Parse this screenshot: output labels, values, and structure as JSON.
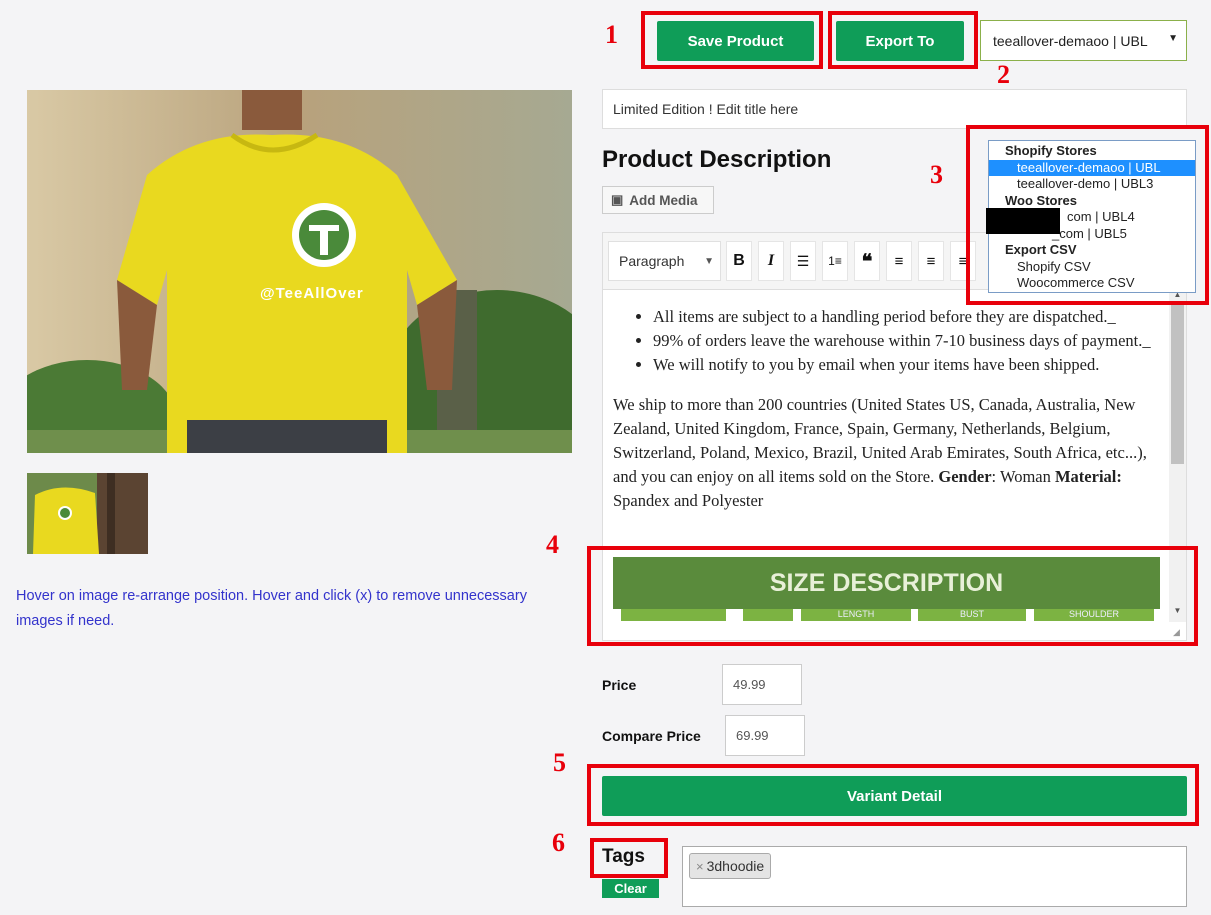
{
  "toolbar": {
    "save_label": "Save Product",
    "export_label": "Export To",
    "store_select_value": "teeallover-demaoo | UBL"
  },
  "product": {
    "title": "Limited Edition ! Edit title here",
    "description_heading": "Product Description",
    "add_media_label": "Add Media",
    "hint": "Hover on image re-arrange position. Hover and click (x) to remove unnecessary images if need.",
    "image_logo_text": "@TeeAllOver"
  },
  "editor": {
    "format_value": "Paragraph",
    "bullets": [
      "All items are subject to a handling period before they are dispatched._",
      "99% of orders leave the warehouse within 7-10 business days of payment._",
      "We will notify to you by email when your items have been shipped."
    ],
    "paragraph_text": "We ship to more than 200 countries (United States US, Canada, Australia, New Zealand, United Kingdom, France, Spain, Germany, Netherlands, Belgium, Switzerland, Poland, Mexico, Brazil, United Arab Emirates, South Africa, etc...), and you can enjoy on all items sold on the Store.",
    "gender_label": "Gender",
    "gender_value": ": Woman",
    "material_label": "Material:",
    "material_value": " Spandex and Polyester",
    "size_banner": "SIZE DESCRIPTION",
    "size_columns": [
      "",
      "",
      "LENGTH",
      "BUST",
      "SHOULDER"
    ]
  },
  "dropdown": {
    "groups": [
      {
        "label": "Shopify Stores",
        "options": [
          "teeallover-demaoo | UBL",
          "teeallover-demo | UBL3"
        ]
      },
      {
        "label": "Woo Stores",
        "options": [
          "com | UBL4",
          "_com | UBL5"
        ]
      },
      {
        "label": "Export CSV",
        "options": [
          "Shopify CSV",
          "Woocommerce CSV"
        ]
      }
    ],
    "selected": "teeallover-demaoo | UBL"
  },
  "pricing": {
    "price_label": "Price",
    "price_value": "49.99",
    "compare_label": "Compare Price",
    "compare_value": "69.99"
  },
  "variant_label": "Variant Detail",
  "tags": {
    "label": "Tags",
    "clear_label": "Clear",
    "items": [
      "3dhoodie"
    ],
    "remove_glyph": "×"
  },
  "annotations": [
    "1",
    "2",
    "3",
    "4",
    "5",
    "6"
  ],
  "colors": {
    "accent_green": "#0f9d58",
    "annotation_red": "#e8000b",
    "shirt_yellow": "#e9d91f",
    "size_banner_green": "#5a8b3c"
  }
}
